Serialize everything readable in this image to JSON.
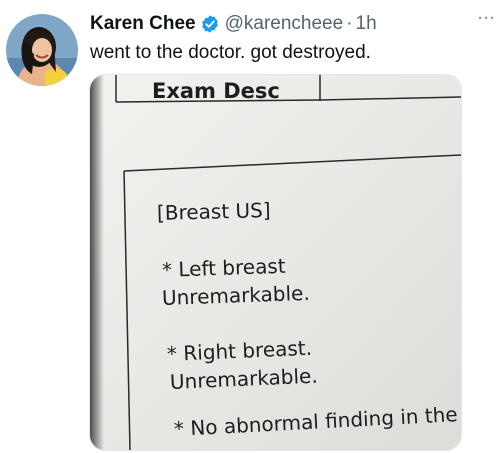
{
  "tweet": {
    "author_name": "Karen Chee",
    "handle": "@karencheee",
    "separator": "·",
    "time": "1h",
    "more_label": "···",
    "text": "went to the doctor. got destroyed."
  },
  "document": {
    "header": "Exam Desc",
    "section": "[Breast US]",
    "lines": [
      "* Left breast",
      "Unremarkable.",
      "* Right breast.",
      "Unremarkable.",
      "* No abnormal finding in the"
    ]
  },
  "colors": {
    "verified_badge": "#1d9bf0",
    "secondary_text": "#536471",
    "paper": "#ecebe8"
  }
}
